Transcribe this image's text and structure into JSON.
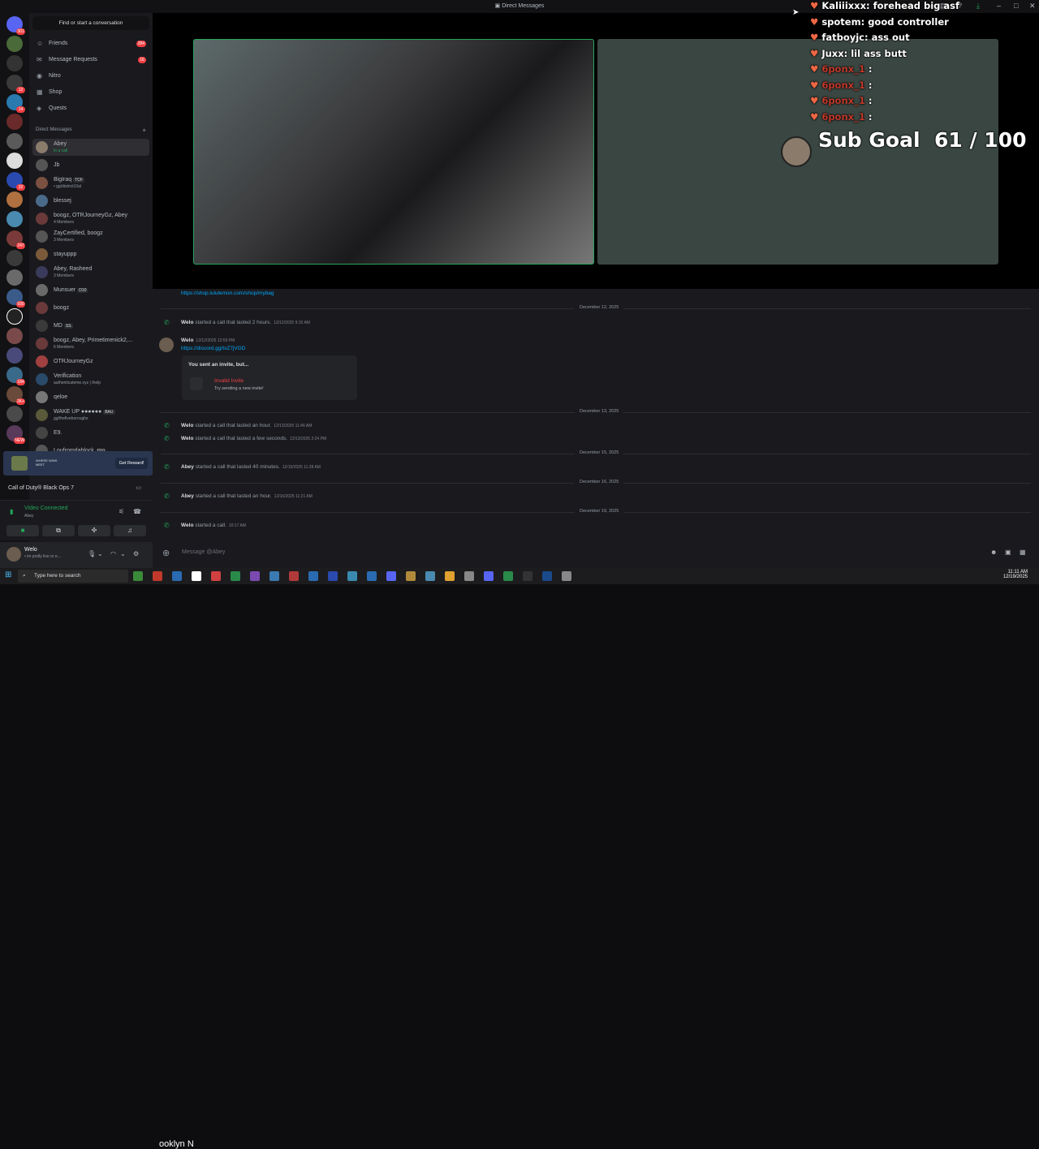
{
  "titlebar": {
    "title": "Direct Messages",
    "icons": [
      "inbox-icon",
      "help-icon",
      "download-icon",
      "minimize-icon",
      "maximize-icon",
      "close-icon"
    ]
  },
  "server_badges": [
    "301",
    "12",
    "14",
    "32",
    "247",
    "930",
    "184",
    "2K+",
    "NEW"
  ],
  "sidebar": {
    "search": "Find or start a conversation",
    "nav": [
      {
        "label": "Friends",
        "icon": "friends-icon",
        "count": "284"
      },
      {
        "label": "Message Requests",
        "icon": "mail-icon",
        "count": "16"
      },
      {
        "label": "Nitro",
        "icon": "nitro-icon",
        "count": ""
      },
      {
        "label": "Shop",
        "icon": "shop-icon",
        "count": ""
      },
      {
        "label": "Quests",
        "icon": "quests-icon",
        "count": ""
      }
    ],
    "dm_header": "Direct Messages",
    "dms": [
      {
        "name": "Abey",
        "sub": "In a call",
        "color": "#8a7b6b"
      },
      {
        "name": "Jb",
        "sub": "",
        "color": "#555"
      },
      {
        "name": "BigIraq",
        "tag": "TCF",
        "sub": "• gg/district10al",
        "color": "#7a5040"
      },
      {
        "name": "blessej",
        "sub": "",
        "color": "#4a6a8a"
      },
      {
        "name": "boogz, OTRJourneyGz, Abey",
        "sub": "4 Members",
        "color": "#6a3a3a"
      },
      {
        "name": "ZayCertified, boogz",
        "sub": "3 Members",
        "color": "#555"
      },
      {
        "name": "stayuppp",
        "sub": "",
        "color": "#7a5a3a"
      },
      {
        "name": "Abey, Rasheed",
        "sub": "3 Members",
        "color": "#3a3a5a"
      },
      {
        "name": "Munsuer",
        "tag": "D10",
        "sub": "",
        "color": "#6a6a6a"
      },
      {
        "name": "boogz",
        "sub": "",
        "color": "#6a3a3a"
      },
      {
        "name": "MD",
        "tag": "SS",
        "sub": "",
        "color": "#3a3a3a"
      },
      {
        "name": "boogz, Abey, Primetimenick2,...",
        "sub": "6 Members",
        "color": "#6a3a3a"
      },
      {
        "name": "OTRJourneyGz",
        "sub": "",
        "color": "#a04040"
      },
      {
        "name": "Verification",
        "sub": "authenticateme.xyz | /help",
        "color": "#2a4a6a"
      },
      {
        "name": "qeloe",
        "sub": "",
        "color": "#777"
      },
      {
        "name": "WAKE UP ●●●●●●",
        "tag": "BAU",
        "sub": "gg/thefiveboroughs",
        "color": "#5a5a3a"
      },
      {
        "name": "E9.",
        "sub": "",
        "color": "#444"
      },
      {
        "name": "Loufromdablock",
        "tag": "D10",
        "sub": "",
        "color": "#555"
      }
    ]
  },
  "promo": {
    "text": "WHERE WINS MEET",
    "button": "Get Reward!"
  },
  "game": {
    "label": "Call of Duty® Black Ops 7"
  },
  "voice": {
    "status": "Video Connected",
    "with": "Abey"
  },
  "user": {
    "name": "Welo",
    "status": "• im prolly live or e..."
  },
  "chat": {
    "top_link": "https://shop.lululemon.com/shop/mybag",
    "dates": [
      "December 12, 2025",
      "December 13, 2025",
      "December 15, 2025",
      "December 16, 2025",
      "December 19, 2025"
    ],
    "calls": [
      {
        "user": "Welo",
        "text": "started a call that lasted 2 hours.",
        "ts": "12/12/2025 9:15 AM"
      },
      {
        "user": "Welo",
        "text": "started a call that lasted an hour.",
        "ts": "12/13/2025 11:46 AM"
      },
      {
        "user": "Welo",
        "text": "started a call that lasted a few seconds.",
        "ts": "12/13/2025 2:24 PM"
      },
      {
        "user": "Abey",
        "text": "started a call that lasted 40 minutes.",
        "ts": "12/15/2025 11:28 AM"
      },
      {
        "user": "Abey",
        "text": "started a call that lasted an hour.",
        "ts": "12/16/2025 11:21 AM"
      },
      {
        "user": "Welo",
        "text": "started a call.",
        "ts": "10:17 AM"
      }
    ],
    "message": {
      "user": "Welo",
      "ts": "12/12/2025 12:59 PM",
      "link": "https://discord.gg/txZ7jVGD"
    },
    "invite": {
      "heading": "You sent an invite, but...",
      "title": "Invalid Invite",
      "sub": "Try sending a new invite!"
    },
    "composer_placeholder": "Message @Abey"
  },
  "overlay": {
    "chat": [
      {
        "user": "Kaliiixxx:",
        "msg": "forehead big asf"
      },
      {
        "user": "spotem:",
        "msg": "good controller"
      },
      {
        "user": "fatboyjc:",
        "msg": "ass out"
      },
      {
        "user": "Juxx:",
        "msg": "lil ass butt"
      },
      {
        "user": "6ponx_1",
        "msg": ":"
      },
      {
        "user": "6ponx_1",
        "msg": ":"
      },
      {
        "user": "6ponx_1",
        "msg": ":"
      },
      {
        "user": "6ponx_1",
        "msg": ":"
      }
    ],
    "sub_goal_label": "Sub Goal",
    "sub_goal_value": "61 / 100",
    "sub_goal_fraction": 0.61
  },
  "taskbar": {
    "search": "Type here to search",
    "stray": "ooklyn N",
    "clock_time": "11:11 AM",
    "clock_date": "12/19/2025"
  }
}
